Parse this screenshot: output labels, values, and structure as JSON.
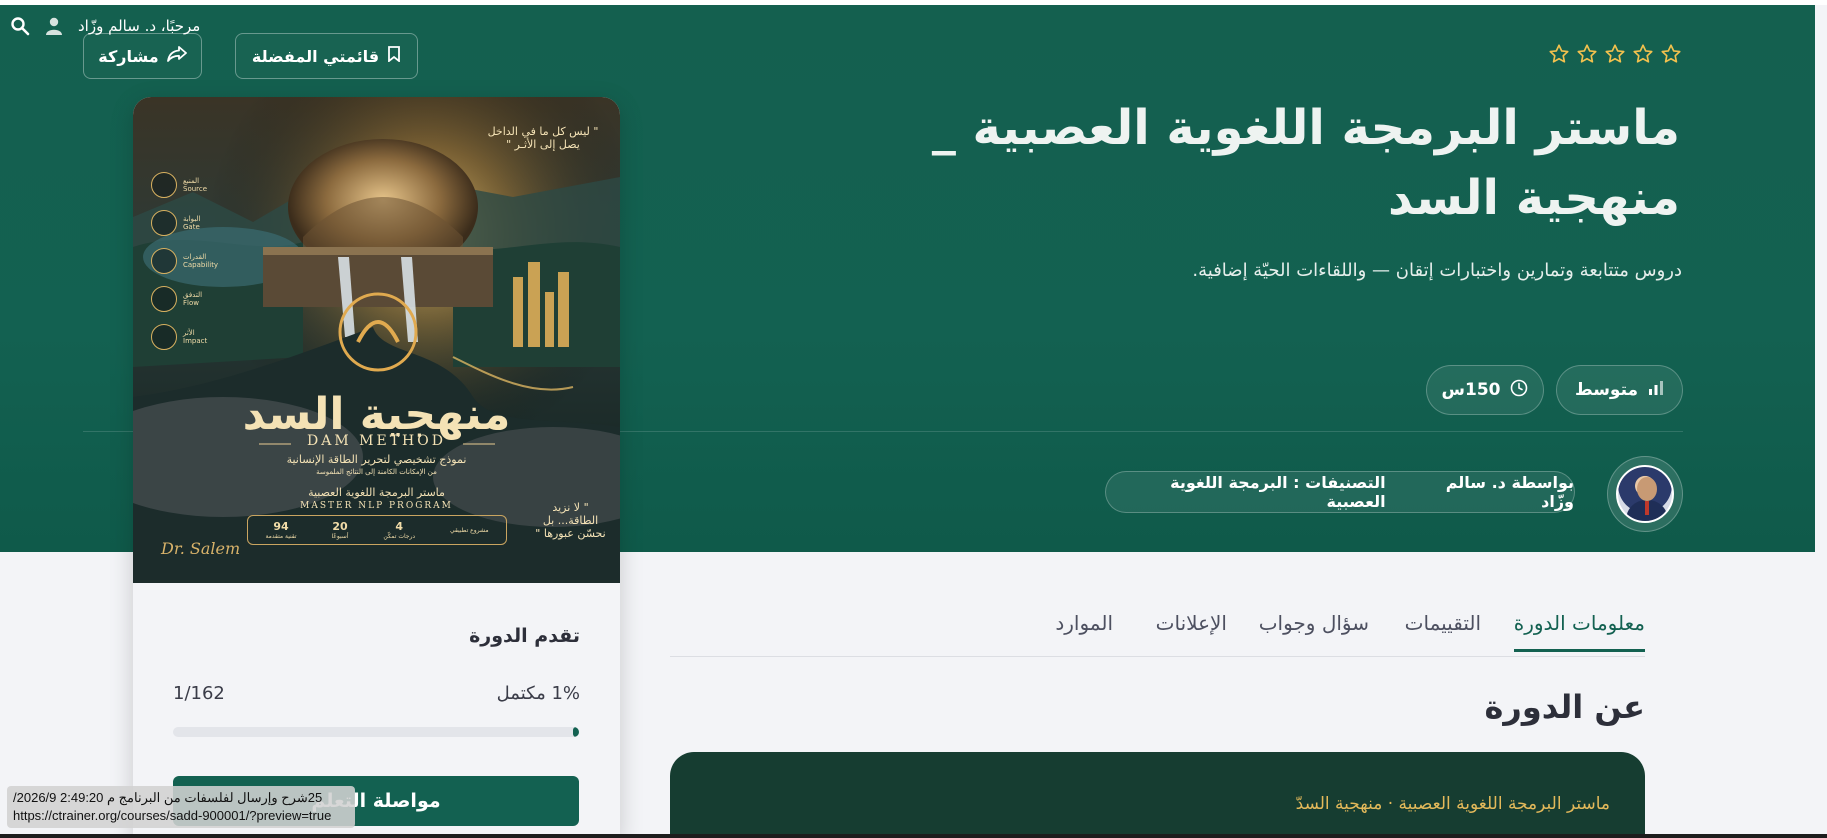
{
  "userbar": {
    "greeting": "مرحبًا، د. سالم وزّاد",
    "search_icon": "search-icon",
    "user_icon": "user-icon"
  },
  "actions": {
    "favorites_label": "قائمتي المفضلة",
    "share_label": "مشاركة"
  },
  "course": {
    "rating_stars": 5,
    "rating_filled": 0,
    "title_line1": "ماستر البرمجة اللغوية العصبية _",
    "title_line2": "منهجية السد",
    "subtitle": "دروس متتابعة وتمارين واختبارات إتقان — واللقاءات الحيّة إضافية.",
    "level": "متوسط",
    "duration": "150س",
    "author_by": "بواسطة د. سالم وزّاد",
    "categories": "التصنيفات : البرمجة اللغوية العصبية"
  },
  "cover": {
    "quote_top": "\" ليس كل ما في الداخل يصل إلى الأثـر \"",
    "quote_bottom": "\" لا نزيد الطاقة... بل نحسّن عبورها \"",
    "arabic_title": "منهجية السد",
    "latin_title": "DAM METHOD",
    "subtitle1": "نموذج تشخيصي لتحرير الطاقة الإنسانية",
    "subtitle2": "من الإمكانات الكامنة إلى النتائج الملموسة",
    "program_ar": "ماستر البرمجة اللغوية العصبية",
    "program_en": "MASTER NLP PROGRAM",
    "signature": "Dr. Salem",
    "side_items": [
      {
        "ar": "المنبع",
        "en": "Source"
      },
      {
        "ar": "البوابة",
        "en": "Gate"
      },
      {
        "ar": "القدرات",
        "en": "Capability"
      },
      {
        "ar": "التدفق",
        "en": "Flow"
      },
      {
        "ar": "الأثر",
        "en": "Impact"
      }
    ],
    "stats": [
      {
        "value": "94",
        "label": "تقنية متقدمة"
      },
      {
        "value": "20",
        "label": "أسبوعًا"
      },
      {
        "value": "4",
        "label": "درجات تمكّن"
      },
      {
        "value": "",
        "label": "مشروع تطبيقي"
      }
    ]
  },
  "progress": {
    "title": "تقدم الدورة",
    "count": "1/162",
    "percent_text": "1% مكتمل",
    "percent": 1,
    "continue_label": "مواصلة التعلم"
  },
  "tabs": [
    {
      "label": "معلومات الدورة",
      "active": true
    },
    {
      "label": "التقييمات",
      "active": false
    },
    {
      "label": "سؤال وجواب",
      "active": false
    },
    {
      "label": "الإعلانات",
      "active": false
    },
    {
      "label": "الموارد",
      "active": false
    }
  ],
  "about": {
    "heading": "عن الدورة",
    "box_label": "ماستر البرمجة اللغوية العصبية · منهجية السدّ"
  },
  "tooltip": {
    "line1": "25شرح وإرسال لفلسفات من البرنامج م 2:49:20 2026/9/",
    "line2": "https://ctrainer.org/courses/sadd-900001/?preview=true"
  },
  "colors": {
    "hero": "#136151",
    "accent": "#136151",
    "star": "#f2c14e",
    "about_box": "#163d31",
    "about_label": "#e3b95a"
  }
}
